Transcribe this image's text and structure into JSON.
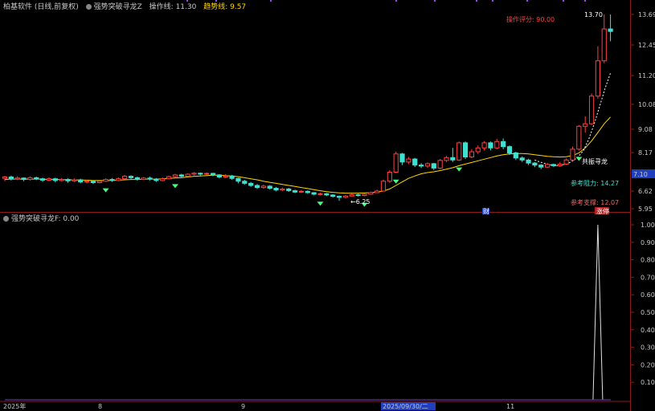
{
  "header": {
    "app": "柏基软件 (日线,前复权)",
    "indicator": "强势突破寻龙Z",
    "op_label": "操作线: 11.30",
    "trend_label": "趋势线: 9.57"
  },
  "main": {
    "rating": "操作评分: 90.00",
    "high_label": "13.70",
    "low_label": "6.25",
    "resonance": "共振寻龙",
    "resistance": "参考阻力: 14.27",
    "support": "参考支撑: 12.07",
    "badge": "涨停",
    "marker_cai": "财",
    "current_price": "7.10",
    "yaxis": [
      "13.69",
      "12.45",
      "11.20",
      "10.08",
      "9.08",
      "8.17",
      "6.62",
      "5.95"
    ]
  },
  "sub": {
    "title": "强势突破寻龙F: 0.00",
    "yaxis": [
      "1.00",
      "0.90",
      "0.80",
      "0.70",
      "0.60",
      "0.50",
      "0.40",
      "0.30",
      "0.20",
      "0.10"
    ],
    "signal": {
      "value": 1.0,
      "index": 94
    }
  },
  "xaxis": {
    "labels": [
      "2025年",
      "8",
      "9",
      "2025/09/30/二",
      "11"
    ]
  },
  "chart_data": {
    "type": "candlestick",
    "candles": [
      [
        6.98,
        7.02,
        6.9,
        7.05
      ],
      [
        7.02,
        6.96,
        6.92,
        7.06
      ],
      [
        6.96,
        6.99,
        6.93,
        7.04
      ],
      [
        6.99,
        6.95,
        6.9,
        7.01
      ],
      [
        6.95,
        7.0,
        6.92,
        7.04
      ],
      [
        7.0,
        6.97,
        6.93,
        7.03
      ],
      [
        6.97,
        6.93,
        6.88,
        7.0
      ],
      [
        6.93,
        6.97,
        6.9,
        7.01
      ],
      [
        6.97,
        6.92,
        6.87,
        7.0
      ],
      [
        6.92,
        6.95,
        6.89,
        6.99
      ],
      [
        6.95,
        6.91,
        6.86,
        6.98
      ],
      [
        6.91,
        6.94,
        6.88,
        6.98
      ],
      [
        6.94,
        6.88,
        6.84,
        6.97
      ],
      [
        6.88,
        6.9,
        6.84,
        6.94
      ],
      [
        6.9,
        6.86,
        6.82,
        6.93
      ],
      [
        6.86,
        6.9,
        6.84,
        6.94
      ],
      [
        6.9,
        6.95,
        6.88,
        6.98
      ],
      [
        6.95,
        6.92,
        6.88,
        6.99
      ],
      [
        6.92,
        6.97,
        6.9,
        7.01
      ],
      [
        6.97,
        7.04,
        6.95,
        7.08
      ],
      [
        7.04,
        7.0,
        6.96,
        7.07
      ],
      [
        7.0,
        6.95,
        6.92,
        7.03
      ],
      [
        6.95,
        6.99,
        6.93,
        7.02
      ],
      [
        6.99,
        6.96,
        6.92,
        7.03
      ],
      [
        6.96,
        6.92,
        6.88,
        6.99
      ],
      [
        6.92,
        6.97,
        6.9,
        7.01
      ],
      [
        6.97,
        7.03,
        6.95,
        7.06
      ],
      [
        7.03,
        7.08,
        7.0,
        7.12
      ],
      [
        7.08,
        7.04,
        7.0,
        7.12
      ],
      [
        7.04,
        7.1,
        7.02,
        7.14
      ],
      [
        7.1,
        7.15,
        7.07,
        7.2
      ],
      [
        7.15,
        7.1,
        7.06,
        7.18
      ],
      [
        7.1,
        7.14,
        7.07,
        7.18
      ],
      [
        7.14,
        7.08,
        7.04,
        7.17
      ],
      [
        7.08,
        7.02,
        6.98,
        7.1
      ],
      [
        7.02,
        7.05,
        6.99,
        7.1
      ],
      [
        7.05,
        6.98,
        6.94,
        7.08
      ],
      [
        6.98,
        6.9,
        6.84,
        7.0
      ],
      [
        6.9,
        6.84,
        6.8,
        6.94
      ],
      [
        6.84,
        6.78,
        6.74,
        6.88
      ],
      [
        6.78,
        6.72,
        6.68,
        6.82
      ],
      [
        6.72,
        6.76,
        6.69,
        6.8
      ],
      [
        6.76,
        6.7,
        6.66,
        6.79
      ],
      [
        6.7,
        6.65,
        6.61,
        6.74
      ],
      [
        6.65,
        6.68,
        6.62,
        6.72
      ],
      [
        6.68,
        6.63,
        6.59,
        6.71
      ],
      [
        6.63,
        6.58,
        6.54,
        6.66
      ],
      [
        6.58,
        6.61,
        6.55,
        6.65
      ],
      [
        6.61,
        6.56,
        6.52,
        6.64
      ],
      [
        6.56,
        6.5,
        6.46,
        6.58
      ],
      [
        6.5,
        6.52,
        6.46,
        6.56
      ],
      [
        6.52,
        6.47,
        6.43,
        6.55
      ],
      [
        6.47,
        6.42,
        6.38,
        6.5
      ],
      [
        6.42,
        6.38,
        6.25,
        6.45
      ],
      [
        6.38,
        6.43,
        6.35,
        6.47
      ],
      [
        6.43,
        6.48,
        6.4,
        6.52
      ],
      [
        6.48,
        6.45,
        6.41,
        6.52
      ],
      [
        6.45,
        6.5,
        6.42,
        6.54
      ],
      [
        6.5,
        6.56,
        6.48,
        6.6
      ],
      [
        6.56,
        6.62,
        6.54,
        6.66
      ],
      [
        6.62,
        6.9,
        6.6,
        6.95
      ],
      [
        6.9,
        7.2,
        6.85,
        7.3
      ],
      [
        7.2,
        8.1,
        7.15,
        8.2
      ],
      [
        8.1,
        7.7,
        7.55,
        8.15
      ],
      [
        7.7,
        7.85,
        7.6,
        7.95
      ],
      [
        7.85,
        7.55,
        7.45,
        7.9
      ],
      [
        7.55,
        7.5,
        7.4,
        7.65
      ],
      [
        7.5,
        7.62,
        7.42,
        7.68
      ],
      [
        7.62,
        7.4,
        7.3,
        7.66
      ],
      [
        7.4,
        7.78,
        7.35,
        7.85
      ],
      [
        7.78,
        7.92,
        7.7,
        8.0
      ],
      [
        7.92,
        7.8,
        7.7,
        8.35
      ],
      [
        7.8,
        8.55,
        7.75,
        8.6
      ],
      [
        8.55,
        7.95,
        7.85,
        8.6
      ],
      [
        7.95,
        8.2,
        7.9,
        8.3
      ],
      [
        8.2,
        8.35,
        8.1,
        8.45
      ],
      [
        8.35,
        8.55,
        8.25,
        8.62
      ],
      [
        8.55,
        8.35,
        8.25,
        8.6
      ],
      [
        8.35,
        8.6,
        8.3,
        8.7
      ],
      [
        8.6,
        8.4,
        8.3,
        8.72
      ],
      [
        8.4,
        8.15,
        8.05,
        8.45
      ],
      [
        8.15,
        7.9,
        7.8,
        8.2
      ],
      [
        7.9,
        7.8,
        7.7,
        7.98
      ],
      [
        7.8,
        7.65,
        7.55,
        7.86
      ],
      [
        7.65,
        7.55,
        7.45,
        7.7
      ],
      [
        7.55,
        7.45,
        7.35,
        7.6
      ],
      [
        7.45,
        7.58,
        7.4,
        7.66
      ],
      [
        7.58,
        7.52,
        7.45,
        7.62
      ],
      [
        7.52,
        7.6,
        7.46,
        7.7
      ],
      [
        7.6,
        7.8,
        7.55,
        7.88
      ],
      [
        7.8,
        8.3,
        7.75,
        8.4
      ],
      [
        8.3,
        9.2,
        8.25,
        9.25
      ],
      [
        9.2,
        9.3,
        8.95,
        9.6
      ],
      [
        9.3,
        10.4,
        9.25,
        10.5
      ],
      [
        10.4,
        11.8,
        10.3,
        12.4
      ],
      [
        11.8,
        13.1,
        11.7,
        13.7
      ],
      [
        13.1,
        13.0,
        12.6,
        13.7
      ]
    ],
    "trend_line": [
      6.95,
      6.96,
      6.96,
      6.96,
      6.96,
      6.96,
      6.96,
      6.95,
      6.95,
      6.95,
      6.94,
      6.94,
      6.93,
      6.93,
      6.92,
      6.92,
      6.92,
      6.92,
      6.93,
      6.94,
      6.95,
      6.95,
      6.96,
      6.96,
      6.96,
      6.97,
      6.98,
      6.99,
      7.0,
      7.02,
      7.04,
      7.05,
      7.06,
      7.07,
      7.07,
      7.06,
      7.05,
      7.03,
      7.0,
      6.97,
      6.94,
      6.9,
      6.87,
      6.84,
      6.81,
      6.78,
      6.75,
      6.72,
      6.69,
      6.66,
      6.63,
      6.6,
      6.57,
      6.55,
      6.54,
      6.54,
      6.54,
      6.55,
      6.56,
      6.58,
      6.62,
      6.68,
      6.78,
      6.88,
      6.98,
      7.05,
      7.12,
      7.18,
      7.22,
      7.28,
      7.35,
      7.42,
      7.52,
      7.6,
      7.68,
      7.76,
      7.84,
      7.92,
      8.0,
      8.06,
      8.1,
      8.12,
      8.12,
      8.1,
      8.06,
      8.02,
      7.98,
      7.96,
      7.95,
      7.96,
      8.02,
      8.15,
      8.35,
      8.62,
      8.95,
      9.3,
      9.57
    ],
    "op_line_start": 84,
    "op_line": [
      7.8,
      7.7,
      7.62,
      7.55,
      7.52,
      7.55,
      7.62,
      7.75,
      7.95,
      8.25,
      8.7,
      9.3,
      10.0,
      10.7,
      11.3
    ],
    "up_color": "#ff4040",
    "down_color": "#40e0d0",
    "trend_color": "#ffd700",
    "ylim": [
      5.95,
      13.69
    ],
    "sub_ylim": [
      0,
      1.0
    ]
  },
  "colors": {
    "red": "#ff4040",
    "cyan": "#40e0d0",
    "yellow": "#ffd700",
    "axis_border": "#8b1a1a"
  }
}
